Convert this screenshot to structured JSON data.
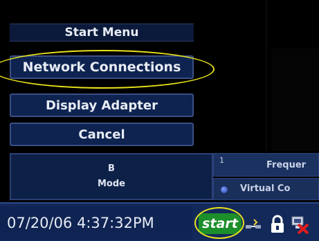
{
  "start_menu": {
    "title": "Start Menu",
    "items": [
      {
        "label": "Network Connections"
      },
      {
        "label": "Display Adapter"
      },
      {
        "label": "Cancel"
      }
    ]
  },
  "panel": {
    "mode_line1": "B",
    "mode_line2": "Mode",
    "row1_number": "1",
    "row1_label": "Frequer",
    "row2_label": "Virtual Co"
  },
  "taskbar": {
    "clock": "07/20/06 4:37:32PM",
    "start_label": "start"
  },
  "icons": [
    "network-icon",
    "lock-icon",
    "disconnect-icon",
    "radio-dot-icon"
  ],
  "colors": {
    "highlight": "#e9e31c",
    "start_green": "#1c8f2a",
    "panel_blue": "#0e2350"
  }
}
